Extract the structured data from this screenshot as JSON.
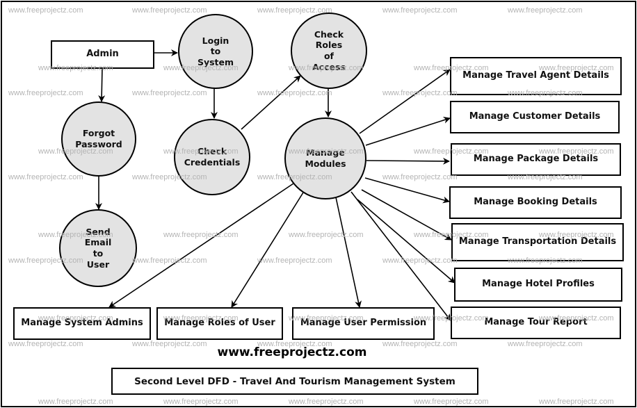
{
  "diagram": {
    "title": "Second Level DFD - Travel And Tourism Management System",
    "site_url": "www.freeprojectz.com",
    "watermark_text": "www.freeprojectz.com",
    "colors": {
      "process_fill": "#e3e3e3",
      "stroke": "#000000",
      "entity_fill": "#ffffff",
      "watermark": "#b4b4b4"
    },
    "entities": [
      {
        "id": "admin",
        "label": "Admin"
      },
      {
        "id": "travel_agent",
        "label": "Manage Travel Agent Details"
      },
      {
        "id": "customer",
        "label": "Manage Customer Details"
      },
      {
        "id": "package",
        "label": "Manage Package Details"
      },
      {
        "id": "booking",
        "label": "Manage Booking Details"
      },
      {
        "id": "transportation",
        "label": "Manage Transportation Details"
      },
      {
        "id": "hotel",
        "label": "Manage Hotel Profiles"
      },
      {
        "id": "tour_report",
        "label": "Manage Tour Report"
      },
      {
        "id": "system_admins",
        "label": "Manage System Admins"
      },
      {
        "id": "roles_of_user",
        "label": "Manage Roles of User"
      },
      {
        "id": "user_permission",
        "label": "Manage User Permission"
      }
    ],
    "processes": [
      {
        "id": "login",
        "label": "Login\nto\nSystem"
      },
      {
        "id": "check_roles",
        "label": "Check\nRoles\nof\nAccess"
      },
      {
        "id": "forgot_password",
        "label": "Forgot\nPassword"
      },
      {
        "id": "check_credentials",
        "label": "Check\nCredentials"
      },
      {
        "id": "manage_modules",
        "label": "Manage\nModules"
      },
      {
        "id": "send_email",
        "label": "Send\nEmail\nto\nUser"
      }
    ],
    "flows": [
      {
        "from": "admin",
        "to": "login"
      },
      {
        "from": "admin",
        "to": "forgot_password"
      },
      {
        "from": "login",
        "to": "check_credentials"
      },
      {
        "from": "check_credentials",
        "to": "check_roles"
      },
      {
        "from": "check_roles",
        "to": "manage_modules"
      },
      {
        "from": "forgot_password",
        "to": "send_email"
      },
      {
        "from": "manage_modules",
        "to": "travel_agent"
      },
      {
        "from": "manage_modules",
        "to": "customer"
      },
      {
        "from": "manage_modules",
        "to": "package"
      },
      {
        "from": "manage_modules",
        "to": "booking"
      },
      {
        "from": "manage_modules",
        "to": "transportation"
      },
      {
        "from": "manage_modules",
        "to": "hotel"
      },
      {
        "from": "manage_modules",
        "to": "tour_report"
      },
      {
        "from": "manage_modules",
        "to": "system_admins"
      },
      {
        "from": "manage_modules",
        "to": "roles_of_user"
      },
      {
        "from": "manage_modules",
        "to": "user_permission"
      }
    ]
  }
}
